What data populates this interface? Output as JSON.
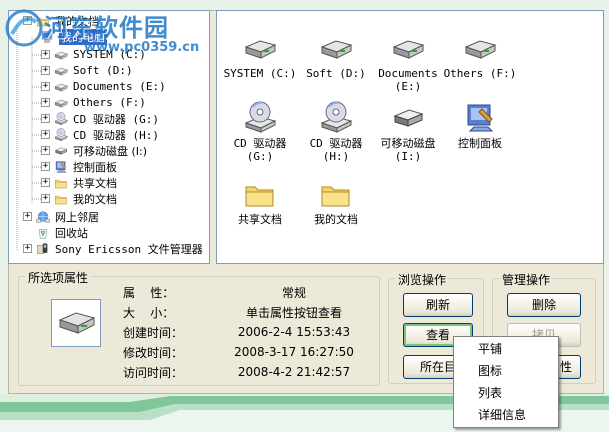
{
  "watermark": {
    "title": "河东软件园",
    "url": "www.pc0359.cn"
  },
  "tree": {
    "items": [
      {
        "label": "我的文档",
        "icon": "folder-icon"
      },
      {
        "label": "我的电脑",
        "icon": "my-computer-icon",
        "selected": true
      },
      {
        "label": "SYSTEM (C:)",
        "icon": "hard-drive-icon"
      },
      {
        "label": "Soft (D:)",
        "icon": "hard-drive-icon"
      },
      {
        "label": "Documents (E:)",
        "icon": "hard-drive-icon"
      },
      {
        "label": "Others (F:)",
        "icon": "hard-drive-icon"
      },
      {
        "label": "CD 驱动器 (G:)",
        "icon": "cd-drive-icon"
      },
      {
        "label": "CD 驱动器 (H:)",
        "icon": "cd-drive-icon"
      },
      {
        "label": "可移动磁盘 (I:)",
        "icon": "removable-disk-icon"
      },
      {
        "label": "控制面板",
        "icon": "control-panel-icon"
      },
      {
        "label": "共享文档",
        "icon": "folder-icon"
      },
      {
        "label": "我的文档",
        "icon": "folder-icon"
      },
      {
        "label": "网上邻居",
        "icon": "network-icon"
      },
      {
        "label": "回收站",
        "icon": "recycle-bin-icon"
      },
      {
        "label": "Sony Ericsson 文件管理器",
        "icon": "phone-manager-icon"
      }
    ]
  },
  "files": {
    "items": [
      {
        "line1": "SYSTEM (C:)",
        "line2": "",
        "icon": "hard-drive-icon"
      },
      {
        "line1": "Soft (D:)",
        "line2": "",
        "icon": "hard-drive-icon"
      },
      {
        "line1": "Documents",
        "line2": "(E:)",
        "icon": "hard-drive-icon"
      },
      {
        "line1": "Others (F:)",
        "line2": "",
        "icon": "hard-drive-icon"
      },
      {
        "line1": "CD 驱动器",
        "line2": "(G:)",
        "icon": "cd-drive-icon"
      },
      {
        "line1": "CD 驱动器",
        "line2": "(H:)",
        "icon": "cd-drive-icon"
      },
      {
        "line1": "可移动磁盘",
        "line2": "(I:)",
        "icon": "removable-disk-icon"
      },
      {
        "line1": "控制面板",
        "line2": "",
        "icon": "control-panel-icon"
      },
      {
        "line1": "共享文档",
        "line2": "",
        "icon": "folder-icon"
      },
      {
        "line1": "我的文档",
        "line2": "",
        "icon": "folder-icon"
      }
    ]
  },
  "properties": {
    "title": "所选项属性",
    "icon": "hard-drive-icon",
    "rows": [
      {
        "key": "属    性：",
        "value": "常规"
      },
      {
        "key": "大    小：",
        "value": "单击属性按钮查看"
      },
      {
        "key": "创建时间：",
        "value": "2006-2-4 15:53:43"
      },
      {
        "key": "修改时间：",
        "value": "2008-3-17 16:27:50"
      },
      {
        "key": "访问时间：",
        "value": "2008-4-2 21:42:57"
      }
    ]
  },
  "browse": {
    "title": "浏览操作",
    "refresh": "刷新",
    "view": "查看",
    "location": "所在目"
  },
  "manage": {
    "title": "管理操作",
    "delete": "删除",
    "copy": "拷贝",
    "properties_tail": "性"
  },
  "context_menu": {
    "items": [
      "平铺",
      "图标",
      "列表",
      "详细信息"
    ]
  }
}
